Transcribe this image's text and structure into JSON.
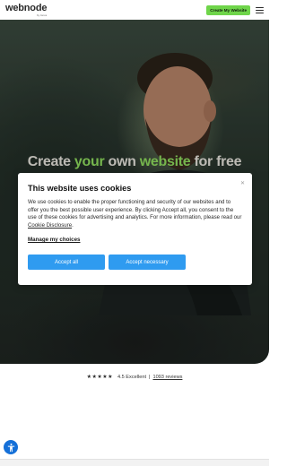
{
  "header": {
    "logo_text": "webnode",
    "logo_tagline": "by Ionos",
    "cta_label": "Create My Website"
  },
  "hero": {
    "title_part1": "Create ",
    "title_accent1": "your",
    "title_part2": " own ",
    "title_accent2": "website",
    "title_part3": " for free"
  },
  "cookie_modal": {
    "title": "This website uses cookies",
    "body_text": "We use cookies to enable the proper functioning and security of our websites and to offer you the best possible user experience. By clicking Accept all, you consent to the use of these cookies for advertising and analytics. For more information, please read our ",
    "body_link": "Cookie Disclosure",
    "body_end": ".",
    "manage_label": "Manage my choices",
    "accept_all_label": "Accept all",
    "accept_necessary_label": "Accept necessary",
    "close_icon": "close-icon"
  },
  "reviews": {
    "stars": "★★★★★",
    "rating_text": "4.5 Excellent",
    "separator": "|",
    "count_text": "1093 reviews"
  },
  "colors": {
    "accent_green": "#6fd54a",
    "button_blue": "#2f9bf0",
    "a11y_blue": "#1570d8"
  },
  "icons": {
    "menu": "hamburger-menu-icon",
    "accessibility": "accessibility-icon",
    "star": "star-icon"
  }
}
